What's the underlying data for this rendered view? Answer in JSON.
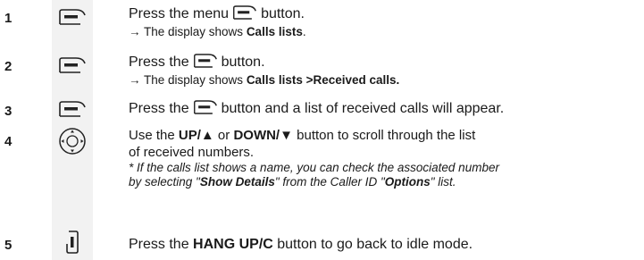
{
  "steps": [
    {
      "number": "1",
      "icon": "menu-button-icon",
      "line_a": "Press the menu",
      "line_b": "button.",
      "result_prefix": "→ The display shows ",
      "result_bold": "Calls lists",
      "result_suffix": "."
    },
    {
      "number": "2",
      "icon": "menu-button-icon",
      "line_a": "Press the",
      "line_b": "button.",
      "result_prefix": "→ The display shows ",
      "result_bold": "Calls lists >Received calls.",
      "result_suffix": ""
    },
    {
      "number": "3",
      "icon": "menu-button-icon",
      "line_a": "Press the",
      "line_b": "button and a list of received calls will appear."
    },
    {
      "number": "4",
      "icon": "navigation-key-icon",
      "pre": "Use the ",
      "up_bold": "UP/",
      "up_sym": "▲",
      "mid": " or ",
      "down_bold": "DOWN/",
      "down_sym": "▼",
      "post": " button to scroll through the list",
      "line2": "of received numbers.",
      "note1": "* If the calls list shows a name, you can check the associated number",
      "note2_a": "by selecting \"",
      "note2_b1": "Show Details",
      "note2_c": "\" from the Caller ID \"",
      "note2_b2": "Options",
      "note2_d": "\" list."
    },
    {
      "number": "5",
      "icon": "hang-up-button-icon",
      "pre": "Press the ",
      "bold": "HANG UP/C",
      "post": " button to go back to idle mode."
    }
  ]
}
